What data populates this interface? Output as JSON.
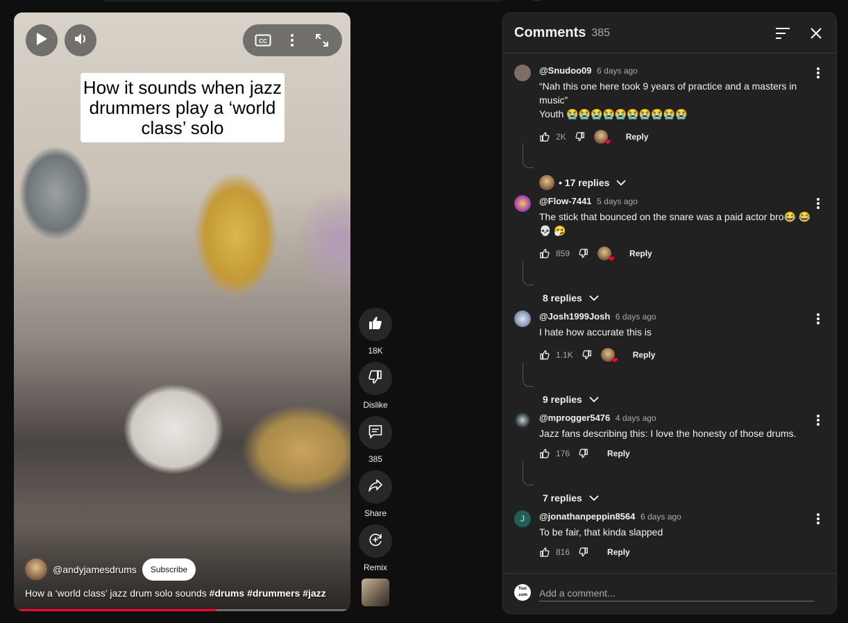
{
  "video": {
    "overlay_title": "How it sounds when jazz drummers play a ‘world class’ solo",
    "channel": "@andyjamesdrums",
    "subscribe_label": "Subscribe",
    "description_text": "How a ‘world class’ jazz drum solo sounds ",
    "hashtags": [
      "#drums",
      "#drummers",
      "#jazz"
    ],
    "progress": 0.6,
    "controls": {
      "play_icon": "play-icon",
      "volume_icon": "volume-icon",
      "cc_icon": "cc-icon",
      "more_icon": "more-vert-icon",
      "fullscreen_icon": "fullscreen-icon"
    }
  },
  "actions": {
    "like_count": "18K",
    "dislike_label": "Dislike",
    "comment_count": "385",
    "share_label": "Share",
    "remix_label": "Remix"
  },
  "comments_panel": {
    "title": "Comments",
    "count": "385",
    "add_placeholder": "Add a comment...",
    "user_avatar_text": "Toxi .com",
    "comments": [
      {
        "handle": "@Snudoo09",
        "time": "6 days ago",
        "text": "“Nah this one here took 9 years of practice and a masters in music”\nYouth 😭😭😭😭😭😭😭😭😭😭",
        "likes": "2K",
        "creator_heart": true,
        "reply_label": "Reply",
        "replies_label": "17 replies",
        "replies_by_creator": true,
        "avatar_color": "#7d6e63"
      },
      {
        "handle": "@Flow-7441",
        "time": "5 days ago",
        "text": "The stick that bounced on the snare was a paid actor bro😂 😂 💀 🤧",
        "likes": "859",
        "creator_heart": true,
        "reply_label": "Reply",
        "replies_label": "8 replies",
        "replies_by_creator": false,
        "avatar_color": "#b54fb0"
      },
      {
        "handle": "@Josh1999Josh",
        "time": "6 days ago",
        "text": "I hate how accurate this is",
        "likes": "1.1K",
        "creator_heart": true,
        "reply_label": "Reply",
        "replies_label": "9 replies",
        "replies_by_creator": false,
        "avatar_color": "#8da0bd"
      },
      {
        "handle": "@mprogger5476",
        "time": "4 days ago",
        "text": "Jazz fans describing this: I love the honesty of those drums.",
        "likes": "176",
        "creator_heart": false,
        "reply_label": "Reply",
        "replies_label": "7 replies",
        "replies_by_creator": false,
        "avatar_color": "#1e2a2e"
      },
      {
        "handle": "@jonathanpeppin8564",
        "time": "6 days ago",
        "text": "To be fair, that kinda slapped",
        "likes": "816",
        "creator_heart": false,
        "reply_label": "Reply",
        "replies_label": "",
        "replies_by_creator": false,
        "avatar_color": "#1f5f56",
        "avatar_letter": "J"
      }
    ]
  }
}
